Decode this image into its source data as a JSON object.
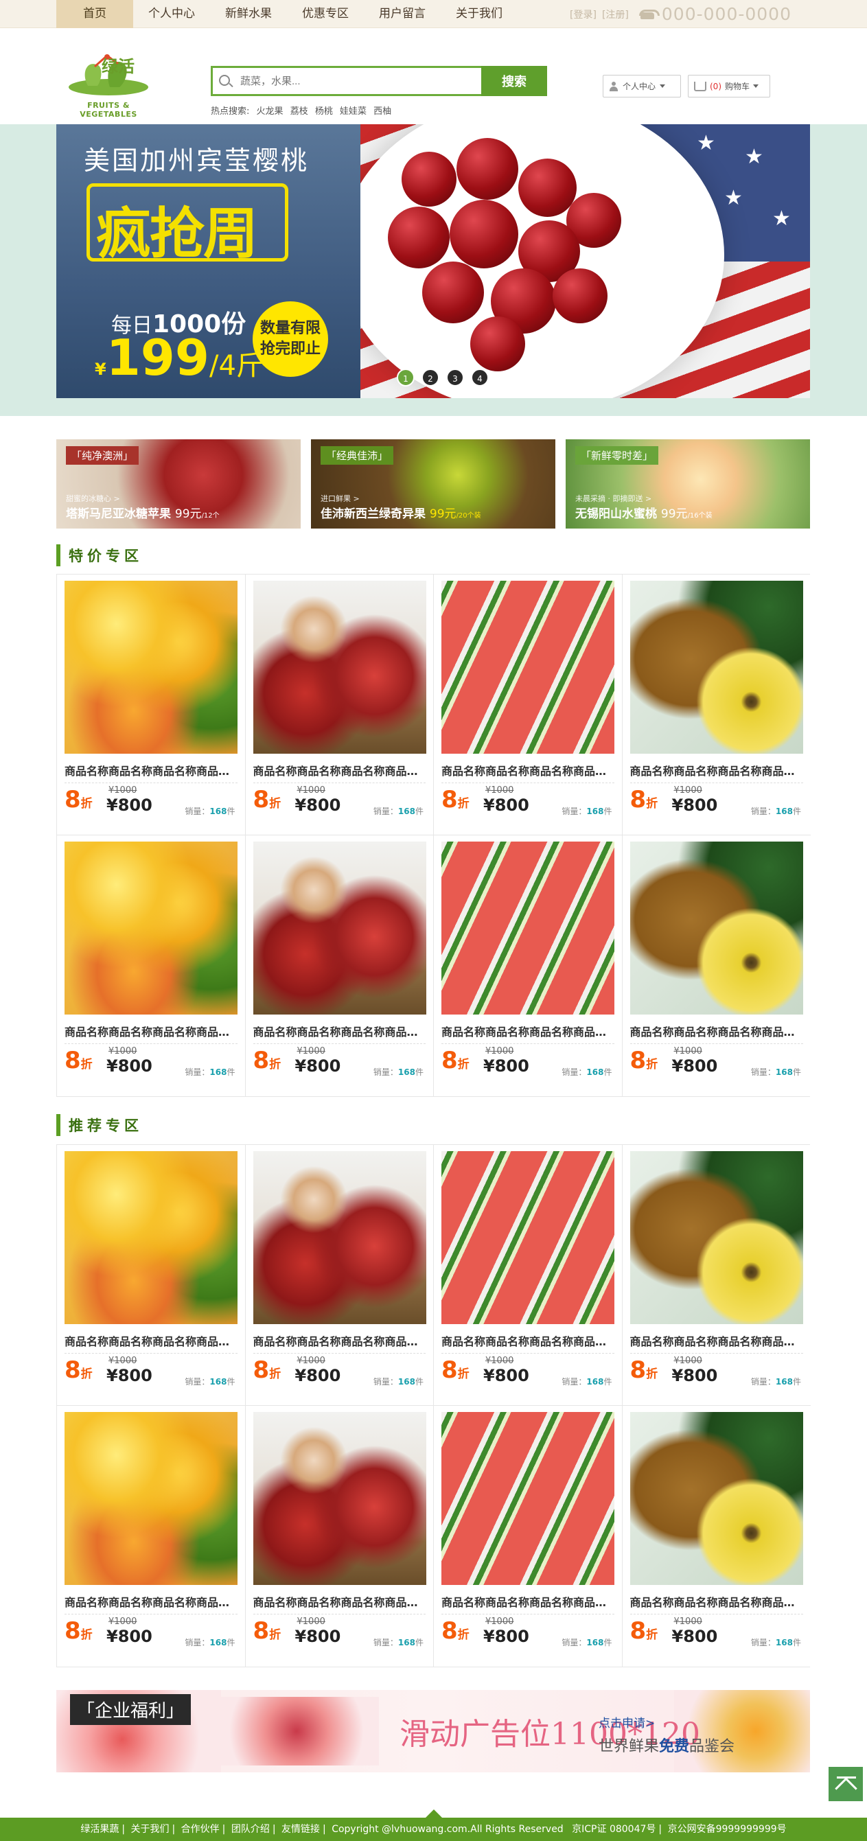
{
  "nav": {
    "items": [
      "首页",
      "个人中心",
      "新鲜水果",
      "优惠专区",
      "用户留言",
      "关于我们"
    ],
    "active_index": 0
  },
  "topright": {
    "login": "[登录]",
    "register": "[注册]",
    "phone": "000-000-0000",
    "phone_icon": "phone-icon"
  },
  "logo": {
    "name": "绿活",
    "sub": "FRUITS & VEGETABLES"
  },
  "search": {
    "placeholder": "蔬菜，水果...",
    "button": "搜索",
    "hot_label": "热点搜索:",
    "hot_terms": [
      "火龙果",
      "荔枝",
      "杨桃",
      "娃娃菜",
      "西柚"
    ]
  },
  "user_center": {
    "label": "个人中心"
  },
  "cart": {
    "count": "(0)",
    "label": "购物车"
  },
  "banner": {
    "title": "美国加州宾莹樱桃",
    "slogan": "疯抢周",
    "daily_prefix": "每日",
    "daily_amount": "1000份",
    "currency": "¥",
    "price": "199",
    "unit": "/4斤",
    "limit_line1": "数量有限",
    "limit_line2": "抢完即止",
    "dots": [
      "1",
      "2",
      "3",
      "4"
    ],
    "active_dot": 0
  },
  "promos": [
    {
      "tag": "「纯净澳洲」",
      "sub": "甜蜜的冰糖心 >",
      "title": "塔斯马尼亚冰糖苹果",
      "price": "99元",
      "unit": "/12个"
    },
    {
      "tag": "「经典佳沛」",
      "sub": "进口鲜果 >",
      "title": "佳沛新西兰绿奇异果",
      "price": "99元",
      "unit": "/20个装"
    },
    {
      "tag": "「新鲜零时差」",
      "sub": "未晨采摘 · 即摘即送 >",
      "title": "无锡阳山水蜜桃",
      "price": "99元",
      "unit": "/16个装"
    }
  ],
  "sections": [
    {
      "title": "特价专区"
    },
    {
      "title": "推荐专区"
    }
  ],
  "product": {
    "name": "商品名称商品名称商品名称商品名称",
    "discount": "8",
    "discount_unit": "折",
    "old_price": "¥1000",
    "new_price": "¥800",
    "sold_label": "销量：",
    "sold_count": "168",
    "sold_unit": "件"
  },
  "product_images": [
    "mango",
    "apple",
    "watermelon",
    "kiwi"
  ],
  "welfare": {
    "tag": "「企业福利」",
    "ad": "滑动广告位1100*120",
    "link": "点击申请>",
    "sub_prefix": "世界鲜果",
    "sub_bold": "免费",
    "sub_suffix": "品鉴会"
  },
  "footer": {
    "items": [
      "绿活果蔬",
      "关于我们",
      "合作伙伴",
      "团队介绍",
      "友情链接",
      "Copyright @lvhuowang.com.All Rights Reserved",
      "京ICP证 080047号",
      "京公网安备9999999999号"
    ]
  },
  "colors": {
    "brand_green": "#5c9c23",
    "accent_orange": "#f45c0a",
    "sold_teal": "#1aa0ad",
    "banner_yellow": "#ffe600"
  }
}
